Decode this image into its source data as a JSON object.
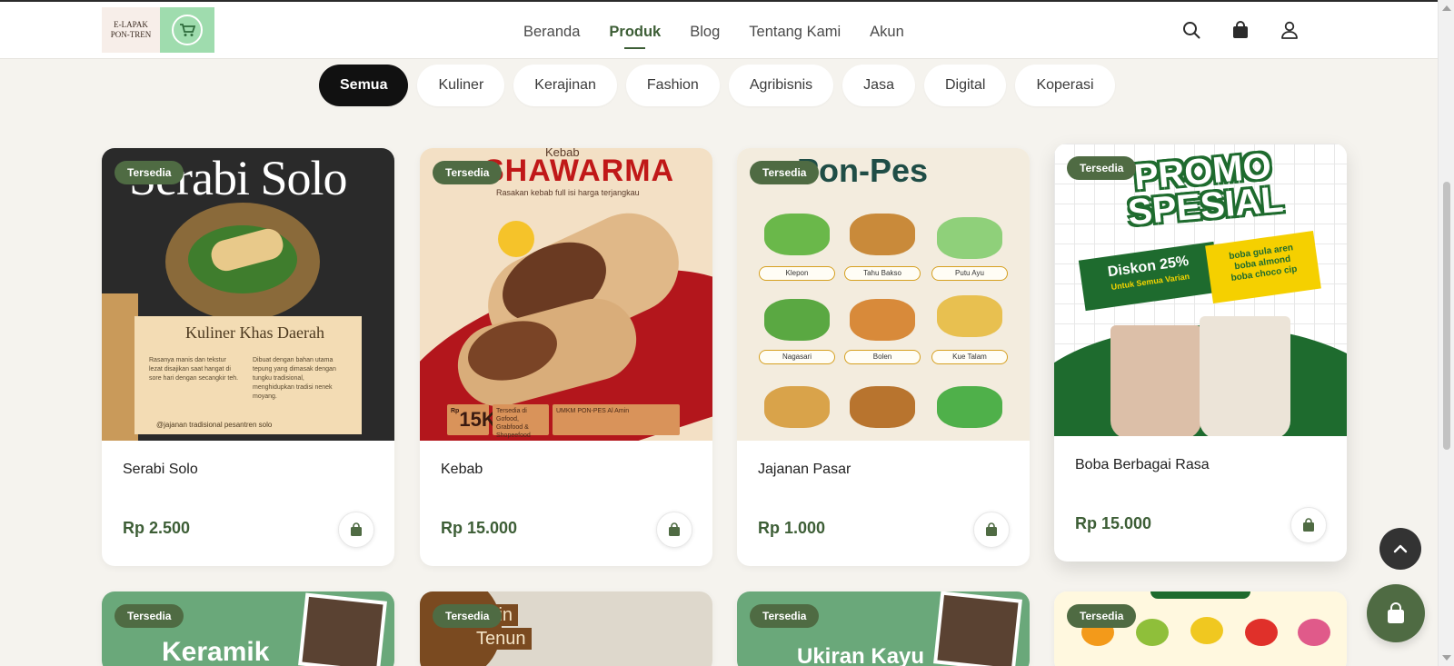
{
  "brand": {
    "logo_text_line1": "E-LAPAK",
    "logo_text_line2": "PON-TREN"
  },
  "nav": {
    "items": [
      {
        "label": "Beranda"
      },
      {
        "label": "Produk"
      },
      {
        "label": "Blog"
      },
      {
        "label": "Tentang Kami"
      },
      {
        "label": "Akun"
      }
    ],
    "active": "Produk"
  },
  "header_icons": [
    "search-icon",
    "shopping-bag-icon",
    "user-icon"
  ],
  "categories": [
    {
      "label": "Semua",
      "active": true
    },
    {
      "label": "Kuliner"
    },
    {
      "label": "Kerajinan"
    },
    {
      "label": "Fashion"
    },
    {
      "label": "Agribisnis"
    },
    {
      "label": "Jasa"
    },
    {
      "label": "Digital"
    },
    {
      "label": "Koperasi"
    }
  ],
  "products": [
    {
      "badge": "Tersedia",
      "name": "Serabi Solo",
      "price": "Rp 2.500",
      "image": {
        "title": "Serabi Solo",
        "heading": "Kuliner Khas Daerah",
        "text_left": "Rasanya manis dan tekstur lezat disajikan saat hangat di sore hari dengan secangkir teh.",
        "text_right": "Dibuat dengan bahan utama tepung yang dimasak dengan tungku tradisional, menghidupkan tradisi nenek moyang.",
        "footer": "@jajanan tradisional pesantren solo"
      }
    },
    {
      "badge": "Tersedia",
      "name": "Kebab",
      "price": "Rp 15.000",
      "image": {
        "top": "Kebab",
        "title": "SHAWARMA",
        "subtitle": "Rasakan kebab full isi harga terjangkau",
        "price_prefix": "Rp",
        "price_big": "15K",
        "delivery": "Tersedia di Gofood, Grabfood & Shopeefood",
        "umkm": "UMKM PON-PES Al Amin"
      }
    },
    {
      "badge": "Tersedia",
      "name": "Jajanan Pasar",
      "price": "Rp 1.000",
      "image": {
        "title": "Pon-Pes",
        "labels": [
          "Klepon",
          "Tahu Bakso",
          "Putu Ayu",
          "Nagasari",
          "Bolen",
          "Kue Talam"
        ]
      }
    },
    {
      "badge": "Tersedia",
      "name": "Boba Berbagai Rasa",
      "price": "Rp 15.000",
      "image": {
        "promo_line1": "PROMO",
        "promo_line2": "SPESIAL",
        "discount": "Diskon 25%",
        "discount_sub": "Untuk Semua Varian",
        "flavors_line1": "boba gula aren",
        "flavors_line2": "boba almond",
        "flavors_line3": "boba choco cip"
      }
    }
  ],
  "products_row2": [
    {
      "badge": "Tersedia",
      "image_title": "Keramik"
    },
    {
      "badge": "Tersedia",
      "image_title_line1": "Kain",
      "image_title_line2": "Tenun"
    },
    {
      "badge": "Tersedia",
      "image_title": "Ukiran Kayu"
    },
    {
      "badge": "Tersedia"
    }
  ],
  "floating": {
    "scroll_top": "chevron-up-icon",
    "cart": "shopping-bag-icon"
  },
  "colors": {
    "brand_green": "#4f6b43",
    "price_green": "#3d5e36",
    "active_pill": "#111111",
    "background": "#f5f3ee"
  }
}
